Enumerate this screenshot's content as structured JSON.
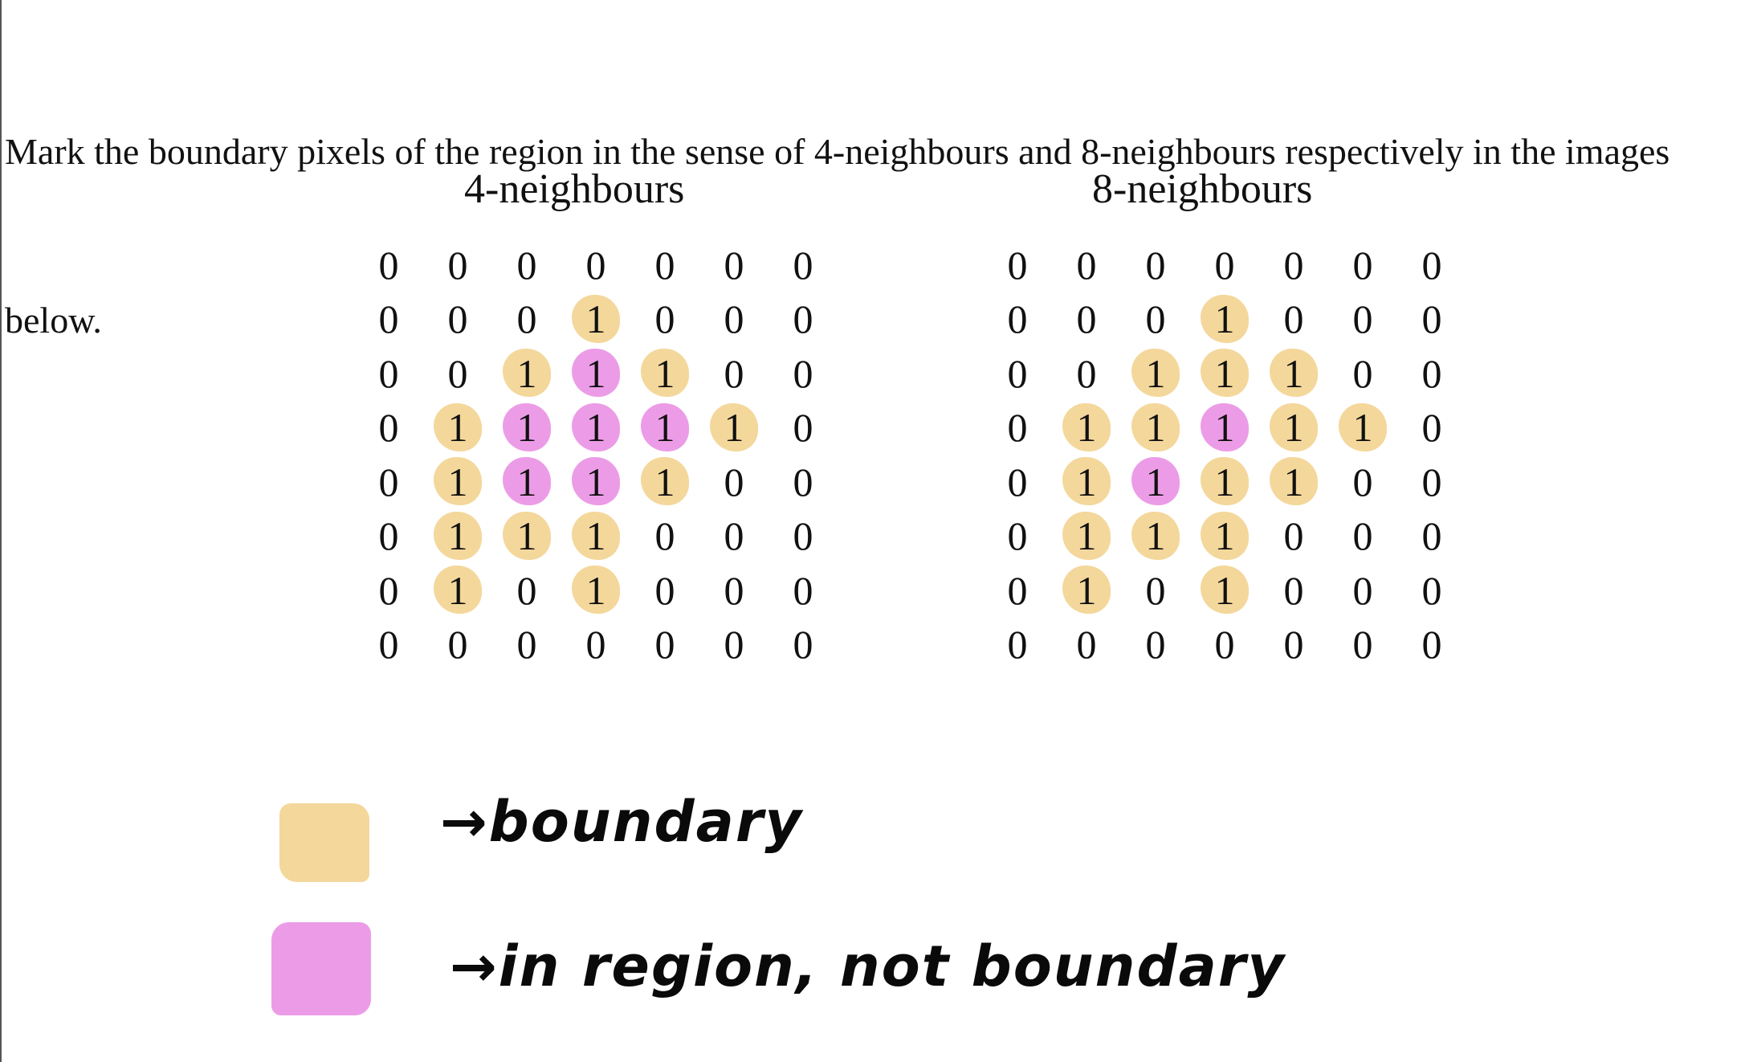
{
  "question": {
    "line1": "Mark the boundary pixels of the region in the sense of 4-neighbours and 8-neighbours respectively in the images",
    "line2": "below."
  },
  "grids": [
    {
      "title": "4-neighbours",
      "rows": [
        [
          "0",
          "0",
          "0",
          "0",
          "0",
          "0",
          "0"
        ],
        [
          "0",
          "0",
          "0",
          "1",
          "0",
          "0",
          "0"
        ],
        [
          "0",
          "0",
          "1",
          "1",
          "1",
          "0",
          "0"
        ],
        [
          "0",
          "1",
          "1",
          "1",
          "1",
          "1",
          "0"
        ],
        [
          "0",
          "1",
          "1",
          "1",
          "1",
          "0",
          "0"
        ],
        [
          "0",
          "1",
          "1",
          "1",
          "0",
          "0",
          "0"
        ],
        [
          "0",
          "1",
          "0",
          "1",
          "0",
          "0",
          "0"
        ],
        [
          "0",
          "0",
          "0",
          "0",
          "0",
          "0",
          "0"
        ]
      ],
      "marks": [
        [
          "",
          "",
          "",
          "",
          "",
          "",
          ""
        ],
        [
          "",
          "",
          "",
          "boundary",
          "",
          "",
          ""
        ],
        [
          "",
          "",
          "boundary",
          "interior",
          "boundary",
          "",
          ""
        ],
        [
          "",
          "boundary",
          "interior",
          "interior",
          "interior",
          "boundary",
          ""
        ],
        [
          "",
          "boundary",
          "interior",
          "interior",
          "boundary",
          "",
          ""
        ],
        [
          "",
          "boundary",
          "boundary",
          "boundary",
          "",
          "",
          ""
        ],
        [
          "",
          "boundary",
          "",
          "boundary",
          "",
          "",
          ""
        ],
        [
          "",
          "",
          "",
          "",
          "",
          "",
          ""
        ]
      ]
    },
    {
      "title": "8-neighbours",
      "rows": [
        [
          "0",
          "0",
          "0",
          "0",
          "0",
          "0",
          "0"
        ],
        [
          "0",
          "0",
          "0",
          "1",
          "0",
          "0",
          "0"
        ],
        [
          "0",
          "0",
          "1",
          "1",
          "1",
          "0",
          "0"
        ],
        [
          "0",
          "1",
          "1",
          "1",
          "1",
          "1",
          "0"
        ],
        [
          "0",
          "1",
          "1",
          "1",
          "1",
          "0",
          "0"
        ],
        [
          "0",
          "1",
          "1",
          "1",
          "0",
          "0",
          "0"
        ],
        [
          "0",
          "1",
          "0",
          "1",
          "0",
          "0",
          "0"
        ],
        [
          "0",
          "0",
          "0",
          "0",
          "0",
          "0",
          "0"
        ]
      ],
      "marks": [
        [
          "",
          "",
          "",
          "",
          "",
          "",
          ""
        ],
        [
          "",
          "",
          "",
          "boundary",
          "",
          "",
          ""
        ],
        [
          "",
          "",
          "boundary",
          "boundary",
          "boundary",
          "",
          ""
        ],
        [
          "",
          "boundary",
          "boundary",
          "interior",
          "boundary",
          "boundary",
          ""
        ],
        [
          "",
          "boundary",
          "interior",
          "boundary",
          "boundary",
          "",
          ""
        ],
        [
          "",
          "boundary",
          "boundary",
          "boundary",
          "",
          "",
          ""
        ],
        [
          "",
          "boundary",
          "",
          "boundary",
          "",
          "",
          ""
        ],
        [
          "",
          "",
          "",
          "",
          "",
          "",
          ""
        ]
      ]
    }
  ],
  "legend": {
    "boundary_label": "→boundary",
    "interior_label": "→in region, not boundary",
    "boundary_color": "#f4d79b",
    "interior_color": "#ec9ce7"
  }
}
